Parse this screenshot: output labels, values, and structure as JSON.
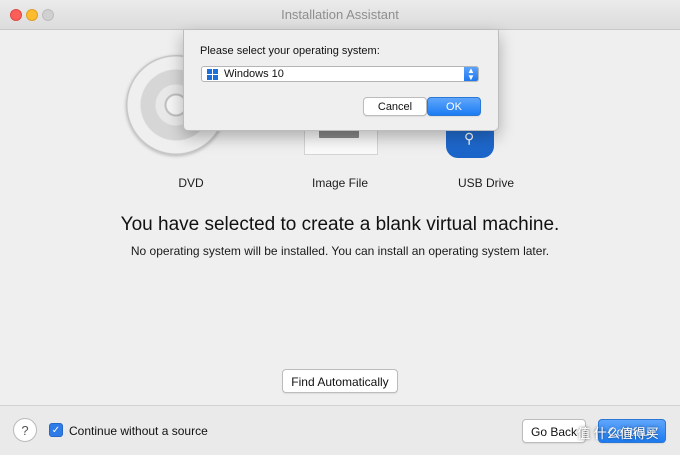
{
  "window": {
    "title": "Installation Assistant"
  },
  "sources": [
    {
      "label": "DVD",
      "icon": "dvd-disc-icon"
    },
    {
      "label": "Image File",
      "icon": "image-file-icon"
    },
    {
      "label": "USB Drive",
      "icon": "usb-drive-icon"
    }
  ],
  "main": {
    "headline": "You have selected to create a blank virtual machine.",
    "subline": "No operating system will be installed. You can install an operating system later.",
    "find_button": "Find Automatically"
  },
  "footer": {
    "help": "?",
    "checkbox_label": "Continue without a source",
    "checkbox_checked": true,
    "back_button": "Go Back",
    "continue_button": "Continue"
  },
  "sheet": {
    "prompt": "Please select your operating system:",
    "selected_os": "Windows 10",
    "cancel": "Cancel",
    "ok": "OK"
  },
  "watermark": "值 什么值得买",
  "colors": {
    "accent": "#1d7cf3"
  }
}
